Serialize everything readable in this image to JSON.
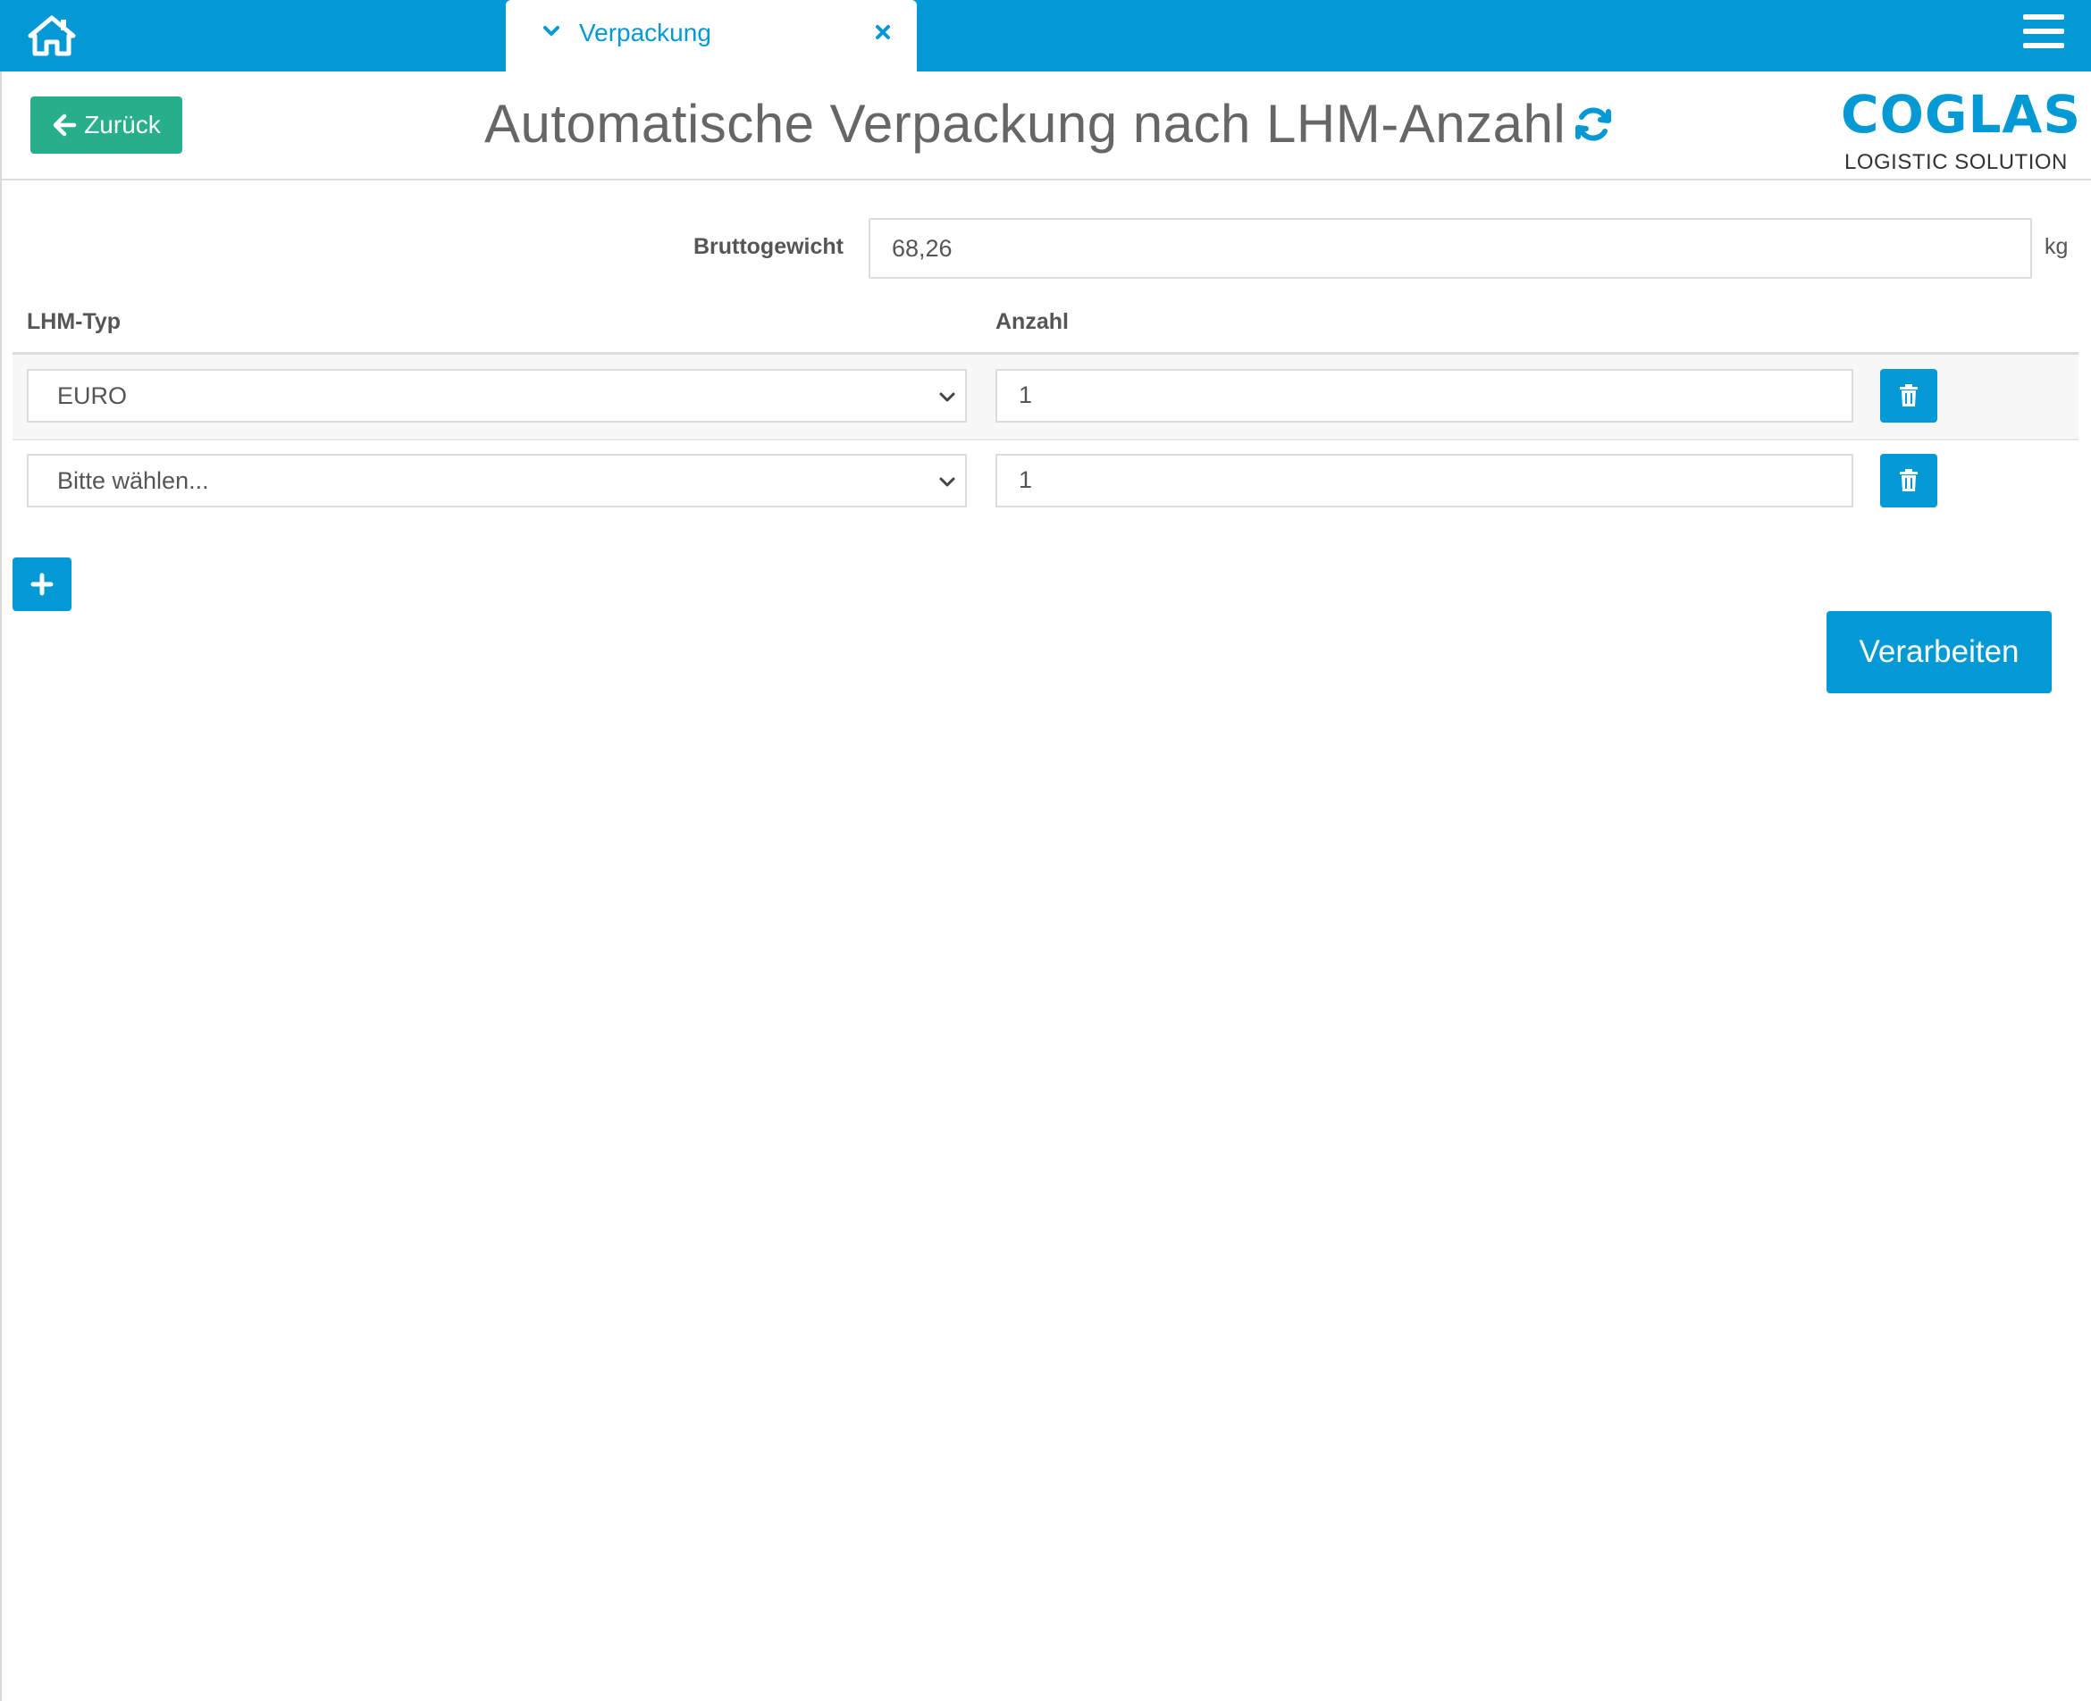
{
  "topbar": {
    "home_icon": "home-icon",
    "menu_icon": "hamburger-menu-icon",
    "tab": {
      "label": "Verpackung",
      "chevron_icon": "chevron-down-icon",
      "close_icon": "close-icon"
    },
    "color": "#0399d4"
  },
  "header": {
    "back_label": "Zurück",
    "back_icon": "arrow-left-icon",
    "title": "Automatische Verpackung nach LHM-Anzahl",
    "refresh_icon": "refresh-icon",
    "logo": {
      "main": "COGLAS",
      "sub": "LOGISTIC SOLUTION"
    }
  },
  "form": {
    "weight_label": "Bruttogewicht",
    "weight_value": "68,26",
    "weight_unit": "kg",
    "columns": {
      "type": "LHM-Typ",
      "count": "Anzahl"
    },
    "rows": [
      {
        "type": "EURO",
        "count": "1"
      },
      {
        "type": "Bitte wählen...",
        "count": "1"
      }
    ],
    "add_icon": "plus-icon",
    "delete_icon": "trash-icon",
    "process_label": "Verarbeiten"
  },
  "colors": {
    "accent": "#0399d4",
    "back_button": "#27ae8b"
  }
}
